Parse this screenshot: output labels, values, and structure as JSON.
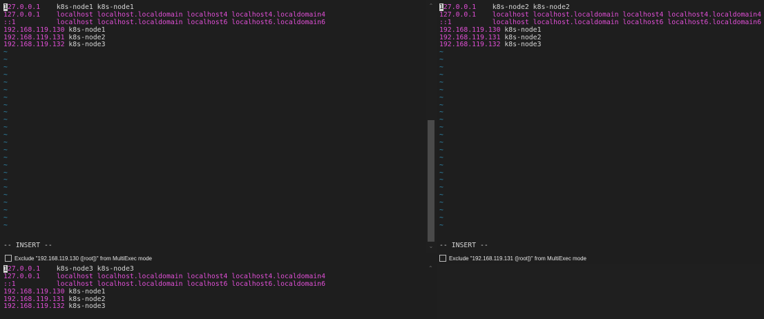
{
  "panes": {
    "tl": {
      "hosts": [
        {
          "ip": "127.0.0.1",
          "pad": "    ",
          "names": "k8s-node1 k8s-node1",
          "mag": false
        },
        {
          "ip": "127.0.0.1",
          "pad": "    ",
          "names": "localhost localhost.localdomain localhost4 localhost4.localdomain4",
          "mag": true
        },
        {
          "ip": "::1",
          "pad": "          ",
          "names": "localhost localhost.localdomain localhost6 localhost6.localdomain6",
          "mag": true
        },
        {
          "ip": "192.168.119.130",
          "pad": " ",
          "names": "k8s-node1",
          "mag": false
        },
        {
          "ip": "192.168.119.131",
          "pad": " ",
          "names": "k8s-node2",
          "mag": false
        },
        {
          "ip": "192.168.119.132",
          "pad": " ",
          "names": "k8s-node3",
          "mag": false
        }
      ],
      "mode": "-- INSERT --",
      "exclude": "Exclude \"192.168.119.130 ([root])\" from MultiExec mode"
    },
    "tr": {
      "hosts": [
        {
          "ip": "127.0.0.1",
          "pad": "    ",
          "names": "k8s-node2 k8s-node2",
          "mag": false
        },
        {
          "ip": "127.0.0.1",
          "pad": "    ",
          "names": "localhost localhost.localdomain localhost4 localhost4.localdomain4",
          "mag": true
        },
        {
          "ip": "::1",
          "pad": "          ",
          "names": "localhost localhost.localdomain localhost6 localhost6.localdomain6",
          "mag": true
        },
        {
          "ip": "192.168.119.130",
          "pad": " ",
          "names": "k8s-node1",
          "mag": false
        },
        {
          "ip": "192.168.119.131",
          "pad": " ",
          "names": "k8s-node2",
          "mag": false
        },
        {
          "ip": "192.168.119.132",
          "pad": " ",
          "names": "k8s-node3",
          "mag": false
        }
      ],
      "mode": "-- INSERT --",
      "exclude": "Exclude \"192.168.119.131 ([root])\" from MultiExec mode"
    },
    "bl": {
      "hosts": [
        {
          "ip": "127.0.0.1",
          "pad": "    ",
          "names": "k8s-node3 k8s-node3",
          "mag": false
        },
        {
          "ip": "127.0.0.1",
          "pad": "    ",
          "names": "localhost localhost.localdomain localhost4 localhost4.localdomain4",
          "mag": true
        },
        {
          "ip": "::1",
          "pad": "          ",
          "names": "localhost localhost.localdomain localhost6 localhost6.localdomain6",
          "mag": true
        },
        {
          "ip": "192.168.119.130",
          "pad": " ",
          "names": "k8s-node1",
          "mag": false
        },
        {
          "ip": "192.168.119.131",
          "pad": " ",
          "names": "k8s-node2",
          "mag": false
        },
        {
          "ip": "192.168.119.132",
          "pad": " ",
          "names": "k8s-node3",
          "mag": false
        }
      ]
    }
  },
  "tilde_char": "~",
  "tilde_count": 24,
  "colors": {
    "background": "#1e1e1e",
    "ip": "#e04fd6",
    "text": "#d6d6d6",
    "tilde": "#2f8fb5",
    "scroll_thumb": "#4a4a4a"
  },
  "icons": {
    "scroll_up": "chevron-up-icon",
    "scroll_down": "chevron-down-icon",
    "checkbox": "checkbox-icon"
  }
}
